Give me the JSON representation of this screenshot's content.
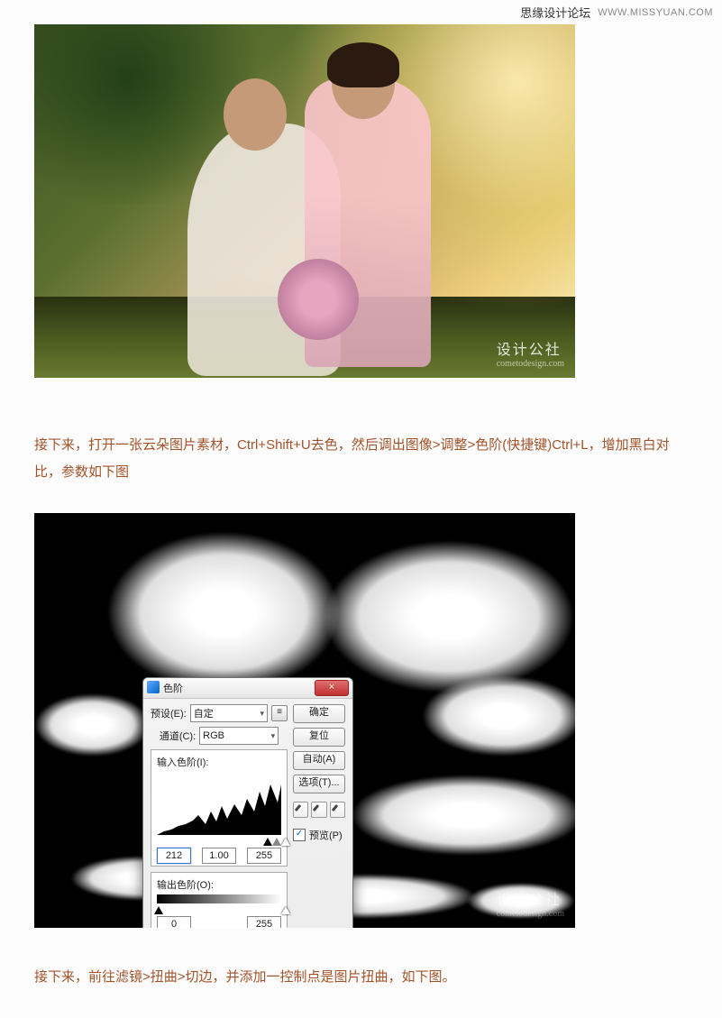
{
  "watermark": {
    "site_cn": "思缘设计论坛",
    "site_url": "WWW.MISSYUAN.COM",
    "img_brand": "设计公社",
    "img_brand_sub": "cometodesign.com"
  },
  "paragraph1": "接下来，打开一张云朵图片素材，Ctrl+Shift+U去色，然后调出图像>调整>色阶(快捷键)Ctrl+L，增加黑白对比，参数如下图",
  "paragraph2": "接下来，前往滤镜>扭曲>切边，并添加一控制点是图片扭曲，如下图。",
  "dialog": {
    "title_icon": "levels-icon",
    "title": "色阶",
    "close": "×",
    "preset_label": "预设(E):",
    "preset_value": "自定",
    "preset_save_icon": "≡",
    "channel_label": "通道(C):",
    "channel_value": "RGB",
    "input_label": "输入色阶(I):",
    "input_values": {
      "black": "212",
      "gamma": "1.00",
      "white": "255"
    },
    "output_label": "输出色阶(O):",
    "output_values": {
      "black": "0",
      "white": "255"
    },
    "btn_ok": "确定",
    "btn_reset": "复位",
    "btn_auto": "自动(A)",
    "btn_options": "选项(T)...",
    "chk_preview": "预览(P)",
    "chk_preview_checked": "✓"
  }
}
